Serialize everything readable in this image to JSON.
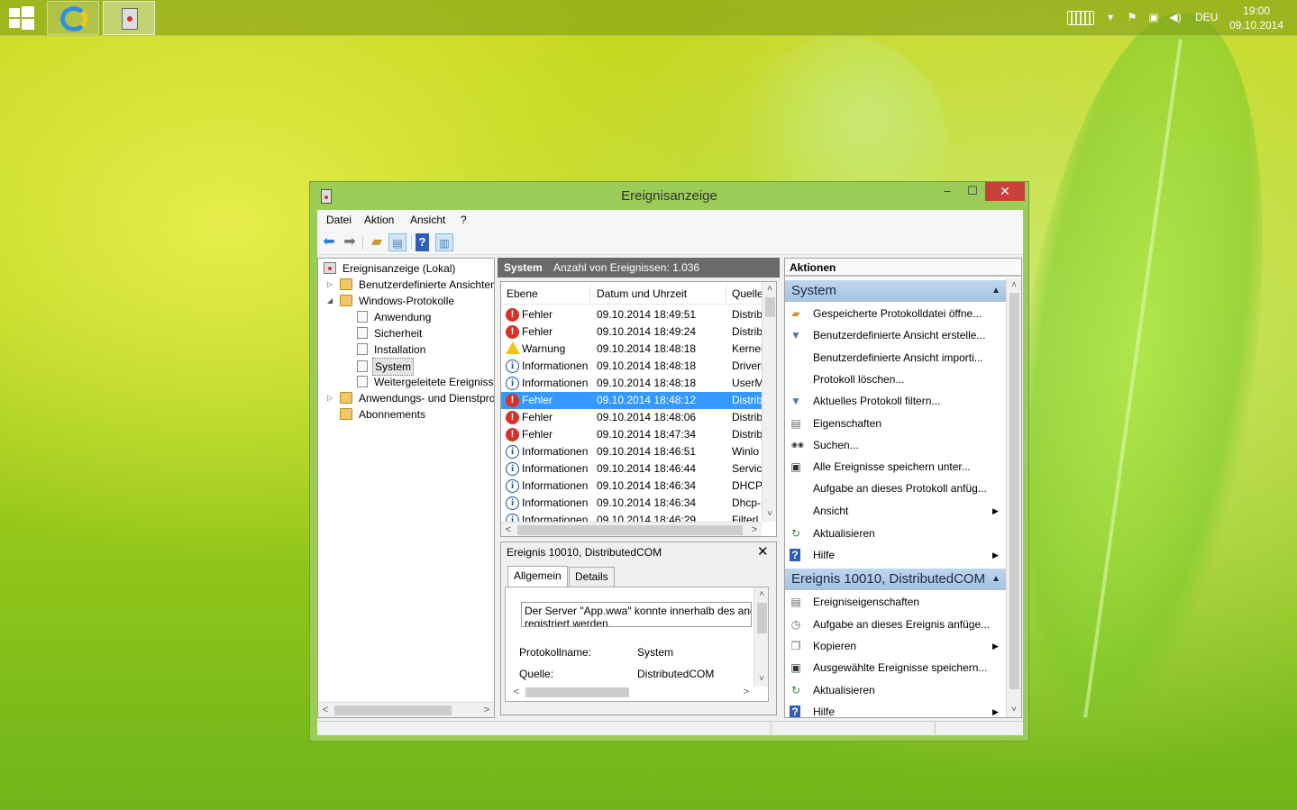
{
  "taskbar": {
    "language": "DEU",
    "time": "19:00",
    "date": "09.10.2014",
    "apps": [
      {
        "icon": "internet-explorer-icon"
      },
      {
        "icon": "event-viewer-icon"
      }
    ]
  },
  "window": {
    "title": "Ereignisanzeige",
    "close_symbol": "✕",
    "menu": [
      "Datei",
      "Aktion",
      "Ansicht",
      "?"
    ],
    "toolbar": [
      "back-arrow-icon",
      "forward-arrow-icon",
      "up-folder-icon",
      "console-tree-icon",
      "help-icon",
      "action-pane-icon"
    ]
  },
  "tree": {
    "items": [
      {
        "label": "Ereignisanzeige (Lokal)",
        "icon": "event-viewer-icon"
      },
      {
        "label": "Benutzerdefinierte Ansichten",
        "icon": "folder-icon",
        "expander": "▷"
      },
      {
        "label": "Windows-Protokolle",
        "icon": "folder-icon",
        "expander": "◢"
      },
      {
        "label": "Anwendung",
        "icon": "log-icon"
      },
      {
        "label": "Sicherheit",
        "icon": "log-icon"
      },
      {
        "label": "Installation",
        "icon": "log-icon"
      },
      {
        "label": "System",
        "icon": "log-icon",
        "selected": true
      },
      {
        "label": "Weitergeleitete Ereignisse",
        "icon": "log-icon"
      },
      {
        "label": "Anwendungs- und Dienstprotokolle",
        "icon": "folder-icon",
        "expander": "▷"
      },
      {
        "label": "Abonnements",
        "icon": "folder-icon"
      }
    ]
  },
  "center": {
    "header_title": "System",
    "header_count": "Anzahl von Ereignissen: 1.036",
    "columns": [
      "Ebene",
      "Datum und Uhrzeit",
      "Quelle"
    ],
    "rows": [
      {
        "level": "Fehler",
        "type": "err",
        "datetime": "09.10.2014 18:49:51",
        "source": "Distrib"
      },
      {
        "level": "Fehler",
        "type": "err",
        "datetime": "09.10.2014 18:49:24",
        "source": "Distrib"
      },
      {
        "level": "Warnung",
        "type": "warn",
        "datetime": "09.10.2014 18:48:18",
        "source": "Kernel"
      },
      {
        "level": "Informationen",
        "type": "info",
        "datetime": "09.10.2014 18:48:18",
        "source": "Driverl"
      },
      {
        "level": "Informationen",
        "type": "info",
        "datetime": "09.10.2014 18:48:18",
        "source": "UserM"
      },
      {
        "level": "Fehler",
        "type": "err",
        "datetime": "09.10.2014 18:48:12",
        "source": "Distrib",
        "selected": true
      },
      {
        "level": "Fehler",
        "type": "err",
        "datetime": "09.10.2014 18:48:06",
        "source": "Distrib"
      },
      {
        "level": "Fehler",
        "type": "err",
        "datetime": "09.10.2014 18:47:34",
        "source": "Distrib"
      },
      {
        "level": "Informationen",
        "type": "info",
        "datetime": "09.10.2014 18:46:51",
        "source": "Winlo"
      },
      {
        "level": "Informationen",
        "type": "info",
        "datetime": "09.10.2014 18:46:44",
        "source": "Servic"
      },
      {
        "level": "Informationen",
        "type": "info",
        "datetime": "09.10.2014 18:46:34",
        "source": "DHCP"
      },
      {
        "level": "Informationen",
        "type": "info",
        "datetime": "09.10.2014 18:46:34",
        "source": "Dhcp-"
      },
      {
        "level": "Informationen",
        "type": "info",
        "datetime": "09.10.2014 18:46:29",
        "source": "Filterl"
      }
    ]
  },
  "detail": {
    "title": "Ereignis 10010, DistributedCOM",
    "close_symbol": "✕",
    "tabs": [
      "Allgemein",
      "Details"
    ],
    "message": "Der Server \"App.wwa\" konnte innerhalb des ang",
    "message_line2": "registriert werden.",
    "fields": [
      {
        "label": "Protokollname:",
        "value": "System"
      },
      {
        "label": "Quelle:",
        "value": "DistributedCOM"
      }
    ]
  },
  "actions": {
    "title": "Aktionen",
    "sections": [
      {
        "title": "System",
        "items": [
          {
            "label": "Gespeicherte Protokolldatei öffne...",
            "icon": "open-log-icon"
          },
          {
            "label": "Benutzerdefinierte Ansicht erstelle...",
            "icon": "filter-icon"
          },
          {
            "label": "Benutzerdefinierte Ansicht importi...",
            "icon": ""
          },
          {
            "label": "Protokoll löschen...",
            "icon": ""
          },
          {
            "label": "Aktuelles Protokoll filtern...",
            "icon": "filter-icon"
          },
          {
            "label": "Eigenschaften",
            "icon": "properties-icon"
          },
          {
            "label": "Suchen...",
            "icon": "binoculars-icon"
          },
          {
            "label": "Alle Ereignisse speichern unter...",
            "icon": "save-icon"
          },
          {
            "label": "Aufgabe an dieses Protokoll anfüg...",
            "icon": ""
          },
          {
            "label": "Ansicht",
            "icon": "",
            "submenu": true
          },
          {
            "label": "Aktualisieren",
            "icon": "refresh-icon"
          },
          {
            "label": "Hilfe",
            "icon": "help-icon",
            "submenu": true
          }
        ]
      },
      {
        "title": "Ereignis 10010, DistributedCOM",
        "items": [
          {
            "label": "Ereigniseigenschaften",
            "icon": "properties-icon"
          },
          {
            "label": "Aufgabe an dieses Ereignis anfüge...",
            "icon": "task-icon"
          },
          {
            "label": "Kopieren",
            "icon": "copy-icon",
            "submenu": true
          },
          {
            "label": "Ausgewählte Ereignisse speichern...",
            "icon": "save-icon"
          },
          {
            "label": "Aktualisieren",
            "icon": "refresh-icon"
          },
          {
            "label": "Hilfe",
            "icon": "help-icon",
            "submenu": true
          }
        ]
      }
    ]
  }
}
